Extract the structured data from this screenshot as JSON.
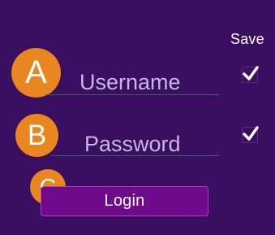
{
  "form": {
    "save_label": "Save",
    "username": {
      "placeholder": "Username",
      "badge": "A",
      "save_checked": true
    },
    "password": {
      "placeholder": "Password",
      "badge": "B",
      "save_checked": true
    },
    "login": {
      "label": "Login",
      "badge": "C"
    }
  },
  "colors": {
    "background": "#3a0e60",
    "badge": "#e8861f",
    "button": "#6f0a8a",
    "button_border": "#b13bd0",
    "placeholder_text": "#c8b5e3",
    "underline": "#2e6b4e"
  },
  "icons": {
    "checkbox": "checkmark-icon"
  }
}
